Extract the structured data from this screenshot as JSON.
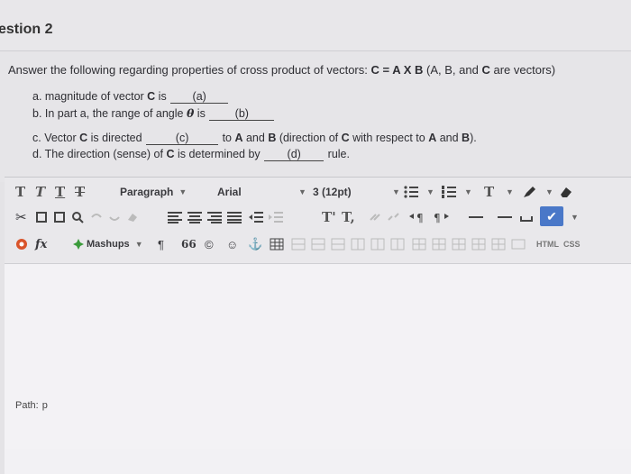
{
  "question": {
    "title": "estion 2",
    "prompt_parts": {
      "p1": "Answer the following regarding properties of cross product of vectors: ",
      "eq_c": "C",
      "p2": " = ",
      "eq_a": "A",
      "p3": " X ",
      "eq_b": "B",
      "p4": " (A, B, and ",
      "eq_c2": "C",
      "p5": " are vectors)"
    },
    "a": {
      "prefix": "a. magnitude of vector ",
      "bold": "C",
      "suffix": " is",
      "blank": "(a)"
    },
    "b": {
      "prefix": "b. In part a, the range of angle ",
      "theta": "θ",
      "suffix": " is",
      "blank": "(b)"
    },
    "c": {
      "prefix": "c. Vector ",
      "bold": "C",
      "mid": " is directed",
      "blank": "(c)",
      "to": "to ",
      "boldA": "A",
      "and": " and ",
      "boldB": "B",
      "dir": " (direction of ",
      "boldC2": "C",
      "wrt": " with respect to ",
      "boldA2": "A",
      "and2": " and ",
      "boldB2": "B",
      "end": ")."
    },
    "d": {
      "prefix": "d. The direction (sense) of ",
      "bold": "C",
      "mid": " is determined by",
      "blank": "(d)",
      "suffix": "rule."
    }
  },
  "editor": {
    "paragraph_label": "Paragraph",
    "font_label": "Arial",
    "size_label": "3 (12pt)",
    "mashups_label": "Mashups",
    "html_label": "HTML",
    "css_label": "CSS",
    "path_label": "Path:",
    "path_value": "p",
    "text_format_glyph": "T",
    "superscript_glyph": "T'",
    "subscript_glyph": "T,",
    "pilcrow_glyph": "¶",
    "quote_glyph": "66",
    "fx_glyph": "fx",
    "cut_glyph": "✂"
  }
}
